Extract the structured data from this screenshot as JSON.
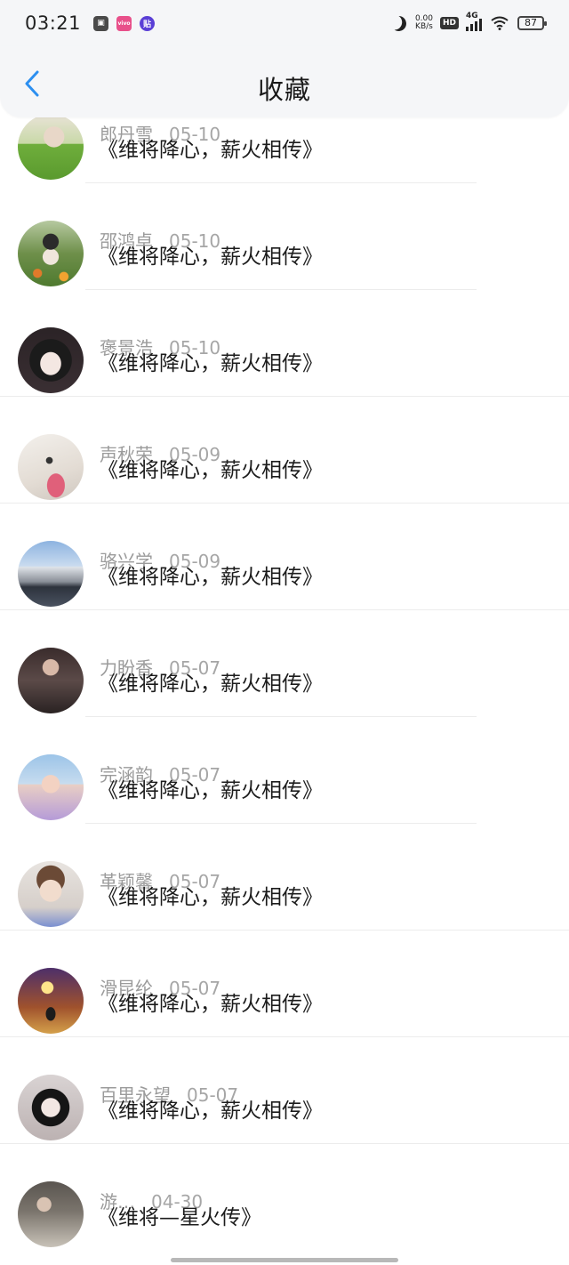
{
  "status_bar": {
    "time": "03:21",
    "app_icons": [
      "gallery-app-icon",
      "vivo-app-icon",
      "paste-app-icon"
    ],
    "app_icon_glyphs": [
      "▣",
      "vivo",
      "贴"
    ],
    "dnd_icon": "moon-icon",
    "net_speed_value": "0.00",
    "net_speed_unit": "KB/s",
    "hd_label": "HD",
    "network_type": "4G",
    "battery": "87"
  },
  "header": {
    "back_icon": "chevron-left-icon",
    "title": "收藏",
    "accent_color": "#2c8ff0"
  },
  "items": [
    {
      "name": "郎丹雪",
      "date": "05-10",
      "title": "《维将降心，薪火相传》"
    },
    {
      "name": "邵鸿卓",
      "date": "05-10",
      "title": "《维将降心，薪火相传》"
    },
    {
      "name": "褒景浩",
      "date": "05-10",
      "title": "《维将降心，薪火相传》"
    },
    {
      "name": "声秋荣",
      "date": "05-09",
      "title": "《维将降心，薪火相传》"
    },
    {
      "name": "骆兴学",
      "date": "05-09",
      "title": "《维将降心，薪火相传》"
    },
    {
      "name": "力盼香",
      "date": "05-07",
      "title": "《维将降心，薪火相传》"
    },
    {
      "name": "完涵韵",
      "date": "05-07",
      "title": "《维将降心，薪火相传》"
    },
    {
      "name": "革颖馨",
      "date": "05-07",
      "title": "《维将降心，薪火相传》"
    },
    {
      "name": "滑昆纶",
      "date": "05-07",
      "title": "《维将降心，薪火相传》"
    },
    {
      "name": "百里永望",
      "date": "05-07",
      "title": "《维将降心，薪火相传》"
    },
    {
      "name": "游…",
      "date": "04-30",
      "title": "《维将—星火传》"
    }
  ]
}
